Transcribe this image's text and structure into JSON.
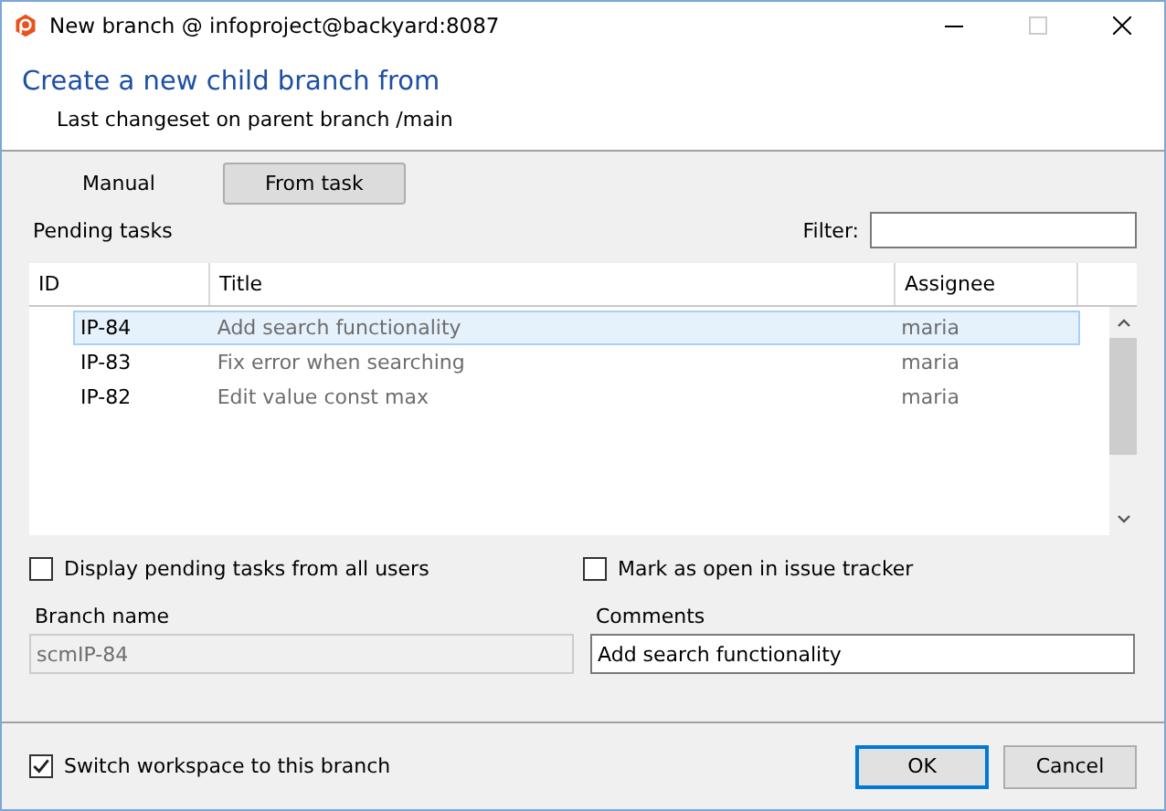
{
  "window": {
    "title": "New branch @ infoproject@backyard:8087"
  },
  "header": {
    "title": "Create a new child branch from",
    "subtitle": "Last changeset on parent branch /main"
  },
  "modes": [
    {
      "label": "Manual",
      "selected": false
    },
    {
      "label": "From task",
      "selected": true
    }
  ],
  "pending_label": "Pending tasks",
  "filter": {
    "label": "Filter:"
  },
  "table": {
    "columns": [
      "ID",
      "Title",
      "Assignee"
    ],
    "rows": [
      {
        "id": "IP-84",
        "title": "Add search functionality",
        "assignee": "maria",
        "selected": true
      },
      {
        "id": "IP-83",
        "title": "Fix error when searching",
        "assignee": "maria",
        "selected": false
      },
      {
        "id": "IP-82",
        "title": "Edit value const max",
        "assignee": "maria",
        "selected": false
      }
    ]
  },
  "options": [
    {
      "label": "Display pending tasks from all users",
      "checked": false
    },
    {
      "label": "Mark as open in issue tracker",
      "checked": false
    }
  ],
  "branch_name": {
    "label": "Branch name",
    "value": "scmIP-84",
    "disabled": true
  },
  "comments": {
    "label": "Comments",
    "value": "Add search functionality"
  },
  "switch_workspace": {
    "label": "Switch workspace to this branch",
    "checked": true
  },
  "buttons": [
    {
      "label": "OK",
      "default": true
    },
    {
      "label": "Cancel",
      "default": false
    }
  ]
}
